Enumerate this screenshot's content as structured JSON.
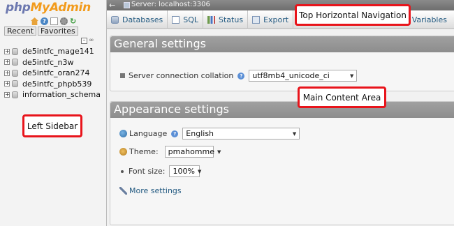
{
  "sidebar": {
    "logo": {
      "part1": "php",
      "part2": "MyAdmin"
    },
    "icons": [
      "home-icon",
      "help-icon",
      "docs-icon",
      "settings-icon",
      "reload-icon"
    ],
    "tabs": {
      "recent": "Recent",
      "favorites": "Favorites"
    },
    "databases": [
      "de5intfc_mage141",
      "de5intfc_n3w",
      "de5intfc_oran274",
      "de5intfc_phpb539",
      "information_schema"
    ]
  },
  "topbar": {
    "server_label": "Server: localhost:3306"
  },
  "nav": {
    "tabs": [
      "Databases",
      "SQL",
      "Status",
      "Export"
    ],
    "variables": "Variables"
  },
  "general": {
    "title": "General settings",
    "collation_label": "Server connection collation",
    "collation_value": "utf8mb4_unicode_ci"
  },
  "appearance": {
    "title": "Appearance settings",
    "language_label": "Language",
    "language_value": "English",
    "theme_label": "Theme:",
    "theme_value": "pmahomme",
    "fontsize_label": "Font size:",
    "fontsize_value": "100%",
    "more_settings": "More settings"
  },
  "annotations": {
    "top_nav": "Top Horizontal Navigation",
    "main": "Main Content Area",
    "sidebar": "Left Sidebar"
  },
  "colors": {
    "annotation_border": "#e8141b",
    "link": "#235a81",
    "panel_header": "#999999"
  }
}
